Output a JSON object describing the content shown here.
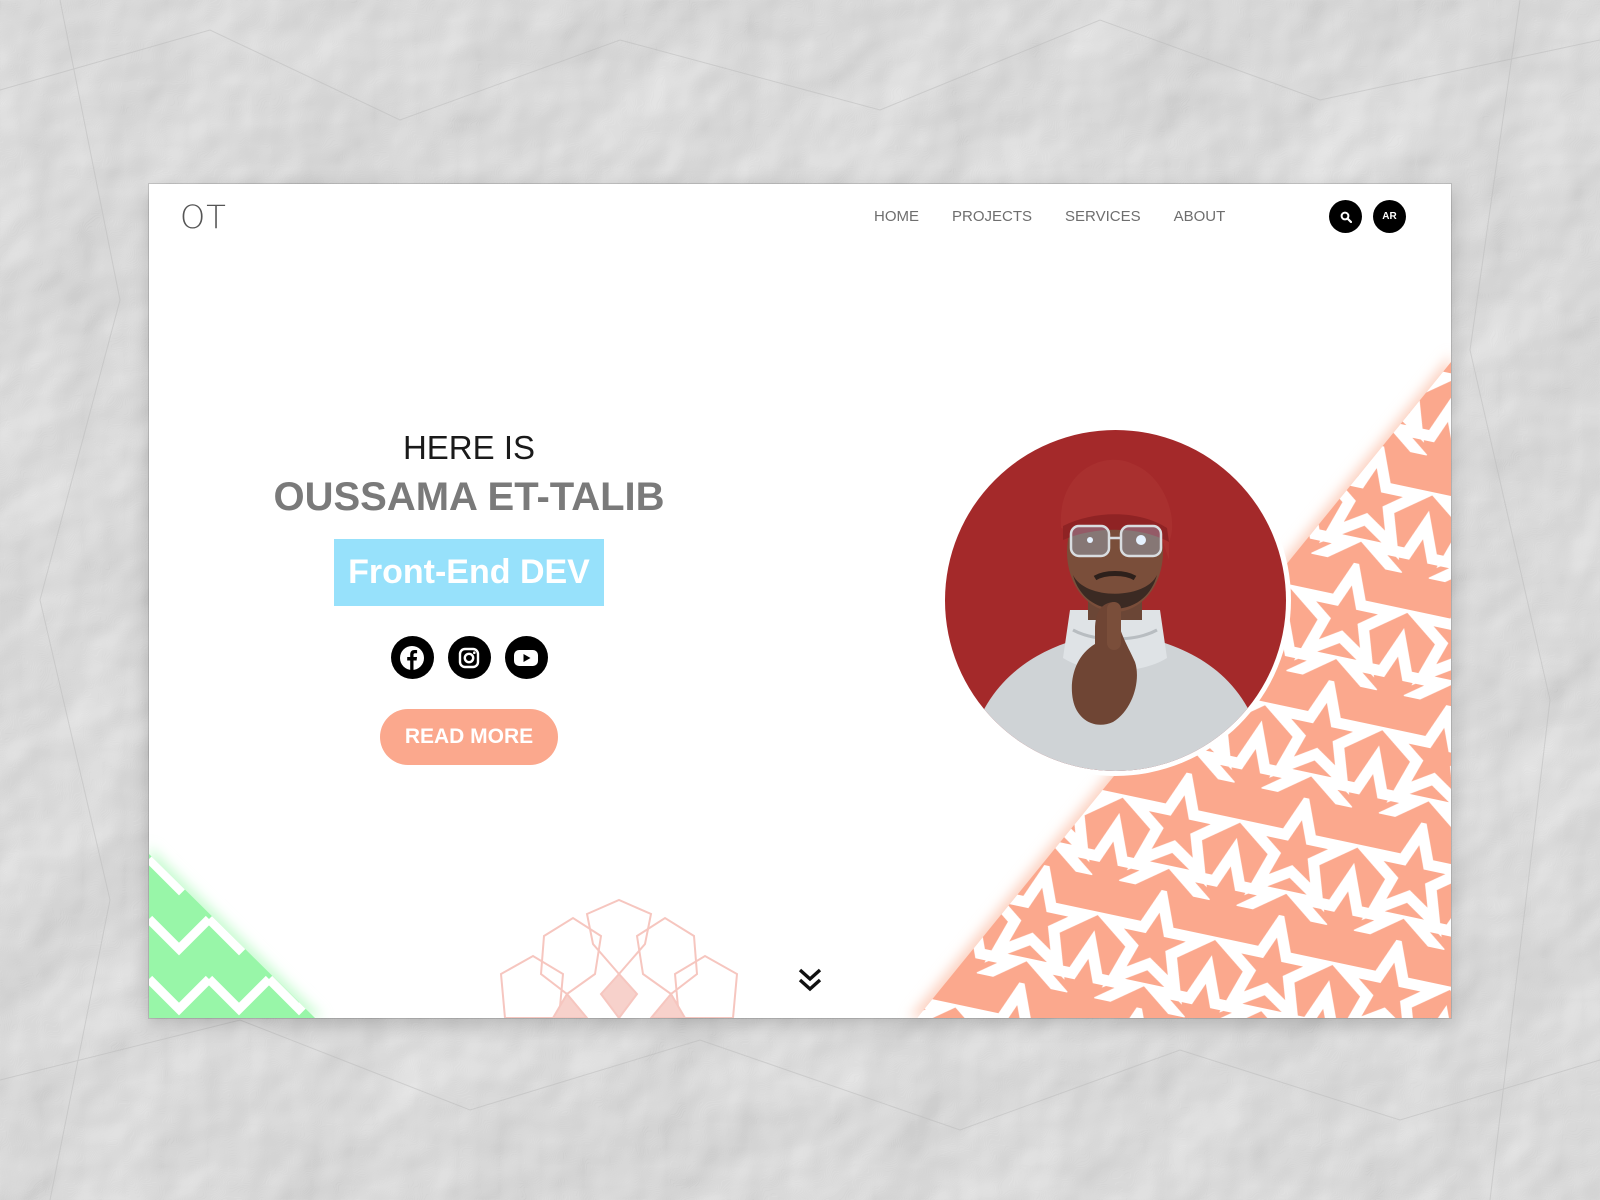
{
  "header": {
    "logo": "OT",
    "nav": [
      "HOME",
      "PROJECTS",
      "SERVICES",
      "ABOUT"
    ],
    "search_icon": "search-icon",
    "language_label": "AR"
  },
  "hero": {
    "greeting": "HERE IS",
    "name": "OUSSAMA ET-TALIB",
    "role": "Front-End DEV",
    "socials": [
      "facebook-icon",
      "instagram-icon",
      "youtube-icon"
    ],
    "cta": "READ MORE"
  },
  "colors": {
    "accent_peach": "#fba88d",
    "accent_cyan": "#97e1fb",
    "accent_green": "#98f6a8",
    "photo_bg": "#a4292a",
    "text_dark": "#1a1a1a",
    "text_gray": "#7a7a7a"
  }
}
